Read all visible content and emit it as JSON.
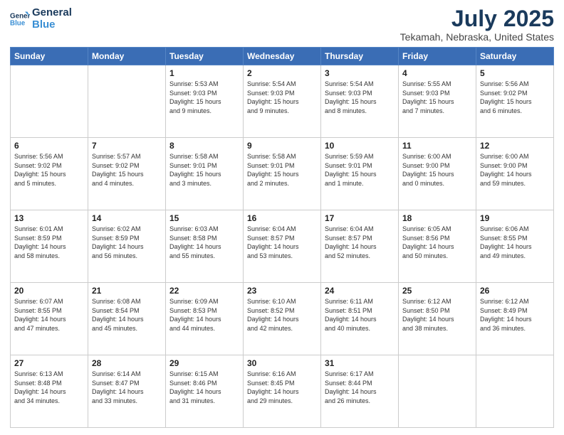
{
  "header": {
    "logo_line1": "General",
    "logo_line2": "Blue",
    "month_title": "July 2025",
    "location": "Tekamah, Nebraska, United States"
  },
  "days_of_week": [
    "Sunday",
    "Monday",
    "Tuesday",
    "Wednesday",
    "Thursday",
    "Friday",
    "Saturday"
  ],
  "weeks": [
    [
      {
        "day": "",
        "info": ""
      },
      {
        "day": "",
        "info": ""
      },
      {
        "day": "1",
        "info": "Sunrise: 5:53 AM\nSunset: 9:03 PM\nDaylight: 15 hours\nand 9 minutes."
      },
      {
        "day": "2",
        "info": "Sunrise: 5:54 AM\nSunset: 9:03 PM\nDaylight: 15 hours\nand 9 minutes."
      },
      {
        "day": "3",
        "info": "Sunrise: 5:54 AM\nSunset: 9:03 PM\nDaylight: 15 hours\nand 8 minutes."
      },
      {
        "day": "4",
        "info": "Sunrise: 5:55 AM\nSunset: 9:03 PM\nDaylight: 15 hours\nand 7 minutes."
      },
      {
        "day": "5",
        "info": "Sunrise: 5:56 AM\nSunset: 9:02 PM\nDaylight: 15 hours\nand 6 minutes."
      }
    ],
    [
      {
        "day": "6",
        "info": "Sunrise: 5:56 AM\nSunset: 9:02 PM\nDaylight: 15 hours\nand 5 minutes."
      },
      {
        "day": "7",
        "info": "Sunrise: 5:57 AM\nSunset: 9:02 PM\nDaylight: 15 hours\nand 4 minutes."
      },
      {
        "day": "8",
        "info": "Sunrise: 5:58 AM\nSunset: 9:01 PM\nDaylight: 15 hours\nand 3 minutes."
      },
      {
        "day": "9",
        "info": "Sunrise: 5:58 AM\nSunset: 9:01 PM\nDaylight: 15 hours\nand 2 minutes."
      },
      {
        "day": "10",
        "info": "Sunrise: 5:59 AM\nSunset: 9:01 PM\nDaylight: 15 hours\nand 1 minute."
      },
      {
        "day": "11",
        "info": "Sunrise: 6:00 AM\nSunset: 9:00 PM\nDaylight: 15 hours\nand 0 minutes."
      },
      {
        "day": "12",
        "info": "Sunrise: 6:00 AM\nSunset: 9:00 PM\nDaylight: 14 hours\nand 59 minutes."
      }
    ],
    [
      {
        "day": "13",
        "info": "Sunrise: 6:01 AM\nSunset: 8:59 PM\nDaylight: 14 hours\nand 58 minutes."
      },
      {
        "day": "14",
        "info": "Sunrise: 6:02 AM\nSunset: 8:59 PM\nDaylight: 14 hours\nand 56 minutes."
      },
      {
        "day": "15",
        "info": "Sunrise: 6:03 AM\nSunset: 8:58 PM\nDaylight: 14 hours\nand 55 minutes."
      },
      {
        "day": "16",
        "info": "Sunrise: 6:04 AM\nSunset: 8:57 PM\nDaylight: 14 hours\nand 53 minutes."
      },
      {
        "day": "17",
        "info": "Sunrise: 6:04 AM\nSunset: 8:57 PM\nDaylight: 14 hours\nand 52 minutes."
      },
      {
        "day": "18",
        "info": "Sunrise: 6:05 AM\nSunset: 8:56 PM\nDaylight: 14 hours\nand 50 minutes."
      },
      {
        "day": "19",
        "info": "Sunrise: 6:06 AM\nSunset: 8:55 PM\nDaylight: 14 hours\nand 49 minutes."
      }
    ],
    [
      {
        "day": "20",
        "info": "Sunrise: 6:07 AM\nSunset: 8:55 PM\nDaylight: 14 hours\nand 47 minutes."
      },
      {
        "day": "21",
        "info": "Sunrise: 6:08 AM\nSunset: 8:54 PM\nDaylight: 14 hours\nand 45 minutes."
      },
      {
        "day": "22",
        "info": "Sunrise: 6:09 AM\nSunset: 8:53 PM\nDaylight: 14 hours\nand 44 minutes."
      },
      {
        "day": "23",
        "info": "Sunrise: 6:10 AM\nSunset: 8:52 PM\nDaylight: 14 hours\nand 42 minutes."
      },
      {
        "day": "24",
        "info": "Sunrise: 6:11 AM\nSunset: 8:51 PM\nDaylight: 14 hours\nand 40 minutes."
      },
      {
        "day": "25",
        "info": "Sunrise: 6:12 AM\nSunset: 8:50 PM\nDaylight: 14 hours\nand 38 minutes."
      },
      {
        "day": "26",
        "info": "Sunrise: 6:12 AM\nSunset: 8:49 PM\nDaylight: 14 hours\nand 36 minutes."
      }
    ],
    [
      {
        "day": "27",
        "info": "Sunrise: 6:13 AM\nSunset: 8:48 PM\nDaylight: 14 hours\nand 34 minutes."
      },
      {
        "day": "28",
        "info": "Sunrise: 6:14 AM\nSunset: 8:47 PM\nDaylight: 14 hours\nand 33 minutes."
      },
      {
        "day": "29",
        "info": "Sunrise: 6:15 AM\nSunset: 8:46 PM\nDaylight: 14 hours\nand 31 minutes."
      },
      {
        "day": "30",
        "info": "Sunrise: 6:16 AM\nSunset: 8:45 PM\nDaylight: 14 hours\nand 29 minutes."
      },
      {
        "day": "31",
        "info": "Sunrise: 6:17 AM\nSunset: 8:44 PM\nDaylight: 14 hours\nand 26 minutes."
      },
      {
        "day": "",
        "info": ""
      },
      {
        "day": "",
        "info": ""
      }
    ]
  ]
}
